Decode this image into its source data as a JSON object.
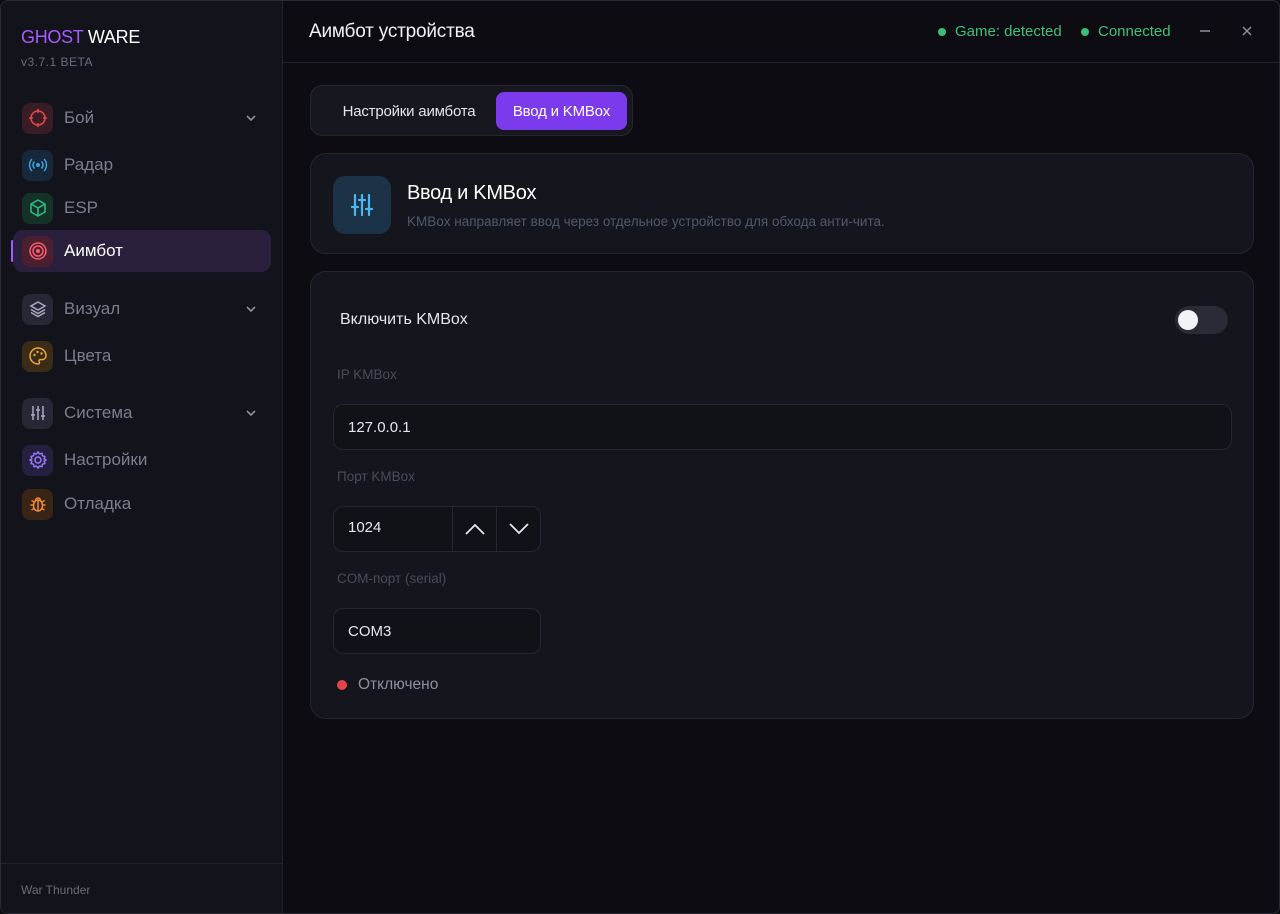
{
  "app": {
    "brand_part1": "GHOST",
    "brand_part2": "WARE",
    "version": "v3.7.1 BETA",
    "game": "War Thunder"
  },
  "sidebar": {
    "items": [
      {
        "label": "Бой",
        "icon": "crosshair-icon",
        "color": "#e0464c",
        "has_chevron": true
      },
      {
        "label": "Радар",
        "icon": "radar-icon",
        "color": "#3aa0e0"
      },
      {
        "label": "ESP",
        "icon": "cube-icon",
        "color": "#2fbf85"
      },
      {
        "label": "Аимбот",
        "icon": "target-icon",
        "color": "#e0464c",
        "active": true
      },
      {
        "label": "Визуал",
        "icon": "layers-icon",
        "color": "#9a9ab0",
        "has_chevron": true
      },
      {
        "label": "Цвета",
        "icon": "palette-icon",
        "color": "#f0a63a"
      },
      {
        "label": "Система",
        "icon": "sliders-icon",
        "color": "#9a9ab0",
        "has_chevron": true
      },
      {
        "label": "Настройки",
        "icon": "gear-icon",
        "color": "#9a7aff"
      },
      {
        "label": "Отладка",
        "icon": "bug-icon",
        "color": "#f08a3a"
      }
    ]
  },
  "header": {
    "title": "Аимбот устройства",
    "status_game": "Game: detected",
    "status_connection": "Connected",
    "status_color": "#38c173"
  },
  "tabs": [
    {
      "label": "Настройки аимбота",
      "active": false
    },
    {
      "label": "Ввод и KMBox",
      "active": true
    }
  ],
  "info_card": {
    "title": "Ввод и KMBox",
    "description": "KMBox направляет ввод через отдельное устройство для обхода анти-чита.",
    "icon": "sliders-icon"
  },
  "settings": {
    "enable_label": "Включить KMBox",
    "enable_value": false,
    "ip_label": "IP KMBox",
    "ip_value": "127.0.0.1",
    "port_label": "Порт KMBox",
    "port_value": "1024",
    "com_label": "COM-порт (serial)",
    "com_value": "COM3",
    "connection_status": "Отключено",
    "connection_status_color": "#e0464c"
  },
  "colors": {
    "accent": "#7c3aed",
    "brand": "#a55cff"
  }
}
